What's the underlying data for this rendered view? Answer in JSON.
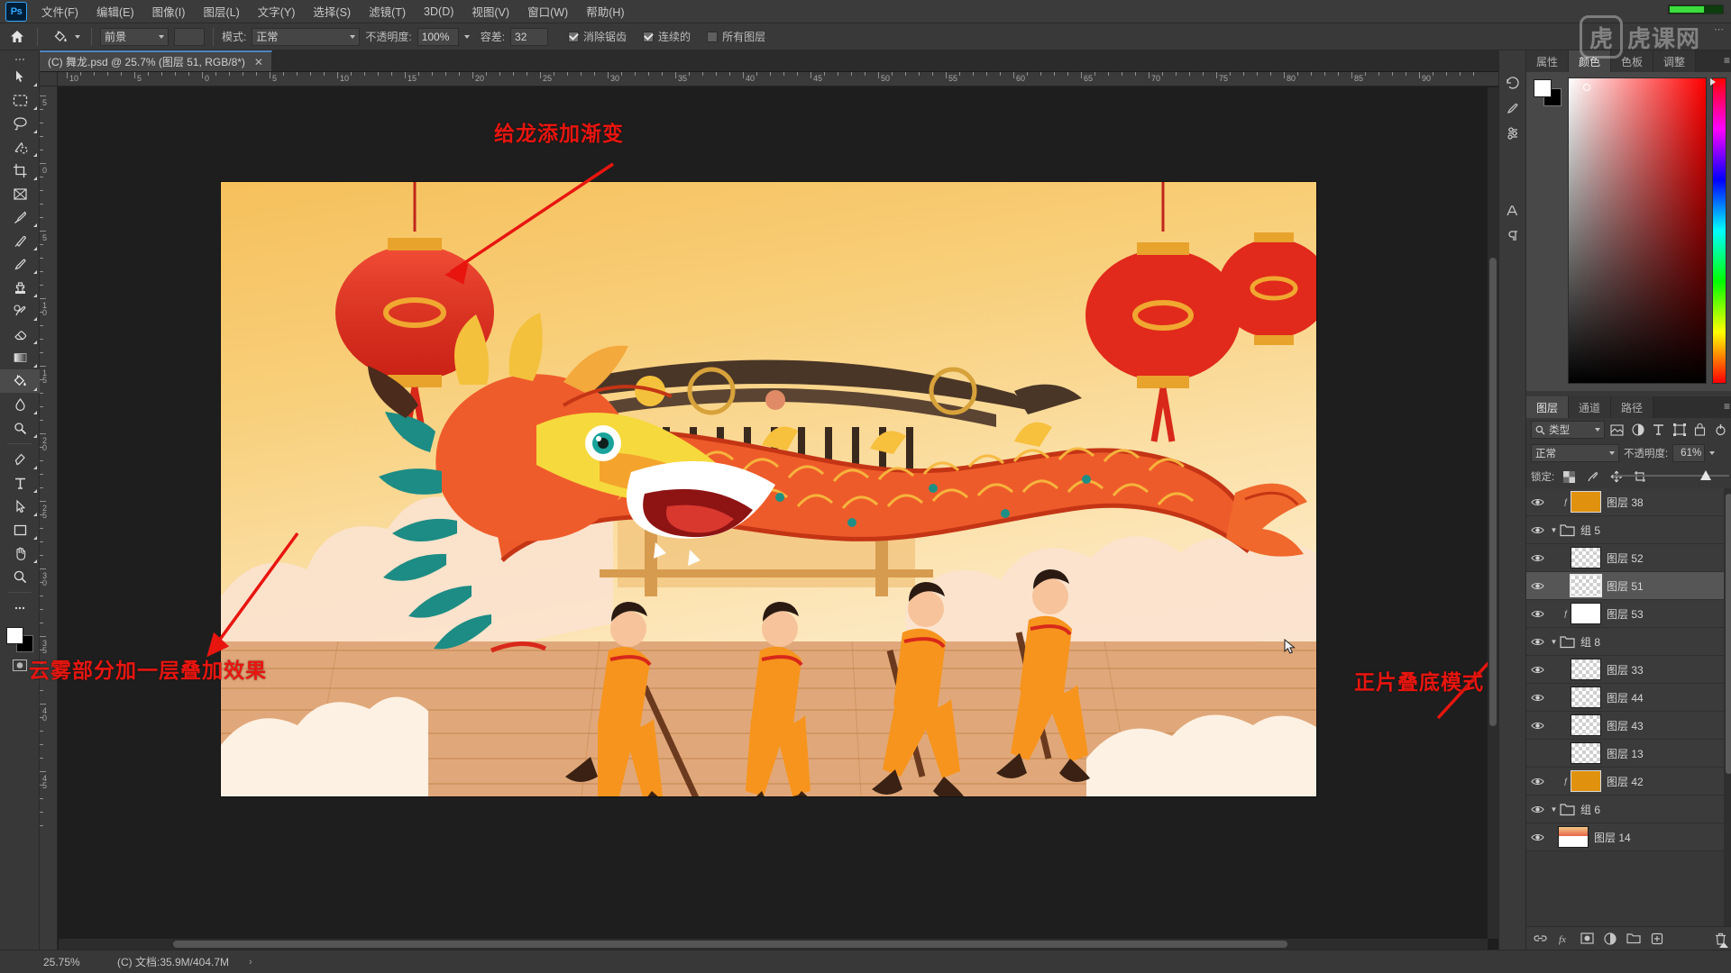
{
  "app": {
    "name": "Adobe Photoshop",
    "logo_text": "Ps"
  },
  "menubar": {
    "items": [
      {
        "label": "文件(F)"
      },
      {
        "label": "编辑(E)"
      },
      {
        "label": "图像(I)"
      },
      {
        "label": "图层(L)"
      },
      {
        "label": "文字(Y)"
      },
      {
        "label": "选择(S)"
      },
      {
        "label": "滤镜(T)"
      },
      {
        "label": "3D(D)"
      },
      {
        "label": "视图(V)"
      },
      {
        "label": "窗口(W)"
      },
      {
        "label": "帮助(H)"
      }
    ]
  },
  "options_bar": {
    "tool_icon": "paint-bucket-icon",
    "home_icon": "home-icon",
    "fill_source": "前景",
    "mode_label": "模式:",
    "mode_value": "正常",
    "opacity_label": "不透明度:",
    "opacity_value": "100%",
    "tolerance_label": "容差:",
    "tolerance_value": "32",
    "antialias_label": "消除锯齿",
    "antialias_checked": true,
    "contiguous_label": "连续的",
    "contiguous_checked": true,
    "all_layers_label": "所有图层",
    "all_layers_checked": false
  },
  "watermark": {
    "box_char": "虎",
    "text": "虎课网"
  },
  "document_tab": {
    "title": "(C) 舞龙.psd @ 25.7% (图层 51, RGB/8*)",
    "close_icon": "close-icon"
  },
  "toolbar": {
    "tools": [
      {
        "name": "move-tool",
        "glyph": "move"
      },
      {
        "name": "rectangular-marquee-tool",
        "glyph": "marquee"
      },
      {
        "name": "lasso-tool",
        "glyph": "lasso"
      },
      {
        "name": "object-selection-tool",
        "glyph": "wand"
      },
      {
        "name": "crop-tool",
        "glyph": "crop"
      },
      {
        "name": "frame-tool",
        "glyph": "frame"
      },
      {
        "name": "eyedropper-tool",
        "glyph": "eyedropper"
      },
      {
        "name": "spot-healing-tool",
        "glyph": "healing"
      },
      {
        "name": "brush-tool",
        "glyph": "brush"
      },
      {
        "name": "clone-stamp-tool",
        "glyph": "stamp"
      },
      {
        "name": "history-brush-tool",
        "glyph": "historybrush"
      },
      {
        "name": "eraser-tool",
        "glyph": "eraser"
      },
      {
        "name": "gradient-tool",
        "glyph": "gradient"
      },
      {
        "name": "paint-bucket-tool",
        "glyph": "bucket",
        "active": true
      },
      {
        "name": "blur-tool",
        "glyph": "blur"
      },
      {
        "name": "dodge-tool",
        "glyph": "dodge"
      },
      {
        "name": "pen-tool",
        "glyph": "pen"
      },
      {
        "name": "type-tool",
        "glyph": "type"
      },
      {
        "name": "path-selection-tool",
        "glyph": "pathselect"
      },
      {
        "name": "rectangle-tool",
        "glyph": "rect"
      },
      {
        "name": "hand-tool",
        "glyph": "hand"
      },
      {
        "name": "zoom-tool",
        "glyph": "zoom"
      },
      {
        "name": "edit-toolbar-button",
        "glyph": "dots"
      }
    ],
    "foreground_color": "#ffffff",
    "background_color": "#000000"
  },
  "rulers": {
    "unit_hint": "px",
    "top_labels": [
      "10",
      "5",
      "0",
      "5",
      "10",
      "15",
      "20",
      "25",
      "30",
      "35",
      "40",
      "45",
      "50",
      "55",
      "60",
      "65",
      "70",
      "75",
      "80",
      "85",
      "90"
    ],
    "left_labels": [
      "5",
      "0",
      "5",
      "10",
      "15",
      "20",
      "25",
      "30",
      "35",
      "40",
      "45"
    ]
  },
  "annotations": [
    {
      "name": "annotation-gradient",
      "text": "给龙添加渐变",
      "color": "#e8150f"
    },
    {
      "name": "annotation-cloud-overlay",
      "text": "云雾部分加一层叠加效果",
      "color": "#e8150f"
    },
    {
      "name": "annotation-multiply-mode",
      "text": "正片叠底模式",
      "color": "#e8150f"
    }
  ],
  "right_dock": {
    "icon_rail": [
      "history-icon",
      "brush-preset-icon",
      "adjustments-icon",
      "character-icon",
      "paragraph-icon"
    ],
    "top_panel": {
      "tabs": [
        {
          "label": "属性",
          "active": false
        },
        {
          "label": "颜色",
          "active": true
        },
        {
          "label": "色板",
          "active": false
        },
        {
          "label": "调整",
          "active": false
        }
      ],
      "menu_icon": "panel-menu-icon",
      "foreground_color": "#ffffff",
      "background_color": "#000000",
      "picker_base_color": "#ff0000"
    },
    "layers_panel": {
      "tabs": [
        {
          "label": "图层",
          "active": true
        },
        {
          "label": "通道",
          "active": false
        },
        {
          "label": "路径",
          "active": false
        }
      ],
      "menu_icon": "panel-menu-icon",
      "filter_label": "类型",
      "filter_icons": [
        "pixel-filter-icon",
        "adjustment-filter-icon",
        "type-filter-icon",
        "shape-filter-icon",
        "smart-object-filter-icon"
      ],
      "filter_toggle_icon": "filter-power-icon",
      "blend_mode": "正常",
      "opacity_label": "不透明度:",
      "opacity_value": "61%",
      "lock_label": "锁定:",
      "lock_icons": [
        "lock-transparent-icon",
        "lock-image-icon",
        "lock-position-icon",
        "lock-artboard-icon"
      ],
      "rows": [
        {
          "name": "图层 14",
          "type": "layer",
          "visible": true,
          "indent": 0,
          "thumb": "art",
          "fx": false,
          "selected": false
        },
        {
          "name": "组 6",
          "type": "group",
          "visible": true,
          "indent": 0,
          "expanded": true,
          "selected": false
        },
        {
          "name": "图层 42",
          "type": "layer",
          "visible": true,
          "indent": 1,
          "thumb": "orange",
          "fx": true,
          "selected": false
        },
        {
          "name": "图层 13",
          "type": "layer",
          "visible": false,
          "indent": 1,
          "thumb": "checker",
          "fx": false,
          "selected": false
        },
        {
          "name": "图层 43",
          "type": "layer",
          "visible": true,
          "indent": 1,
          "thumb": "checker",
          "fx": false,
          "selected": false
        },
        {
          "name": "图层 44",
          "type": "layer",
          "visible": true,
          "indent": 1,
          "thumb": "checker",
          "fx": false,
          "selected": false
        },
        {
          "name": "图层 33",
          "type": "layer",
          "visible": true,
          "indent": 1,
          "thumb": "checker",
          "fx": false,
          "selected": false
        },
        {
          "name": "组 8",
          "type": "group",
          "visible": true,
          "indent": 0,
          "expanded": true,
          "selected": false
        },
        {
          "name": "图层 53",
          "type": "layer",
          "visible": true,
          "indent": 1,
          "thumb": "white",
          "fx": true,
          "selected": false
        },
        {
          "name": "图层 51",
          "type": "layer",
          "visible": true,
          "indent": 1,
          "thumb": "checker",
          "fx": false,
          "selected": true
        },
        {
          "name": "图层 52",
          "type": "layer",
          "visible": true,
          "indent": 1,
          "thumb": "checkerdot",
          "fx": false,
          "selected": false
        },
        {
          "name": "组 5",
          "type": "group",
          "visible": true,
          "indent": 0,
          "expanded": true,
          "selected": false
        },
        {
          "name": "图层 38",
          "type": "layer",
          "visible": true,
          "indent": 1,
          "thumb": "orange",
          "fx": true,
          "selected": false
        }
      ],
      "bottom_icons": [
        "link-layers-icon",
        "layer-style-icon",
        "layer-mask-icon",
        "adjustment-layer-icon",
        "new-group-icon",
        "new-layer-icon",
        "delete-layer-icon"
      ]
    }
  },
  "status_bar": {
    "zoom": "25.75%",
    "doc_info": "(C) 文档:35.9M/404.7M",
    "expander_icon": "chevron-right-icon"
  },
  "artwork": {
    "title": "dragon-dance-illustration",
    "description": "Chinese dragon dance illustration with temple, lanterns, clouds and performers"
  }
}
